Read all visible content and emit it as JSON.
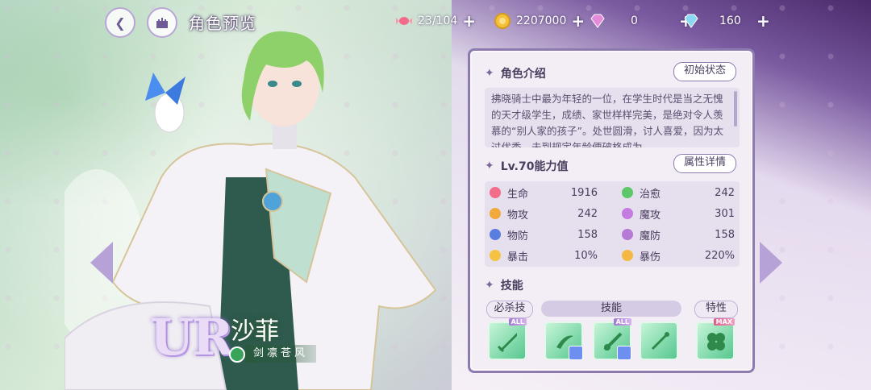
{
  "topbar": {
    "title": "角色预览",
    "resources": [
      {
        "icon": "candy-icon",
        "value": "23/104"
      },
      {
        "icon": "gold-coin-icon",
        "value": "2207000"
      },
      {
        "icon": "pink-gem-icon",
        "value": "0"
      },
      {
        "icon": "blue-diamond-icon",
        "value": "160"
      }
    ]
  },
  "character": {
    "rarity": "UR",
    "name": "沙菲",
    "title": "剑凛苍风"
  },
  "panel": {
    "intro": {
      "heading": "角色介绍",
      "button": "初始状态",
      "text": "拂晓骑士中最为年轻的一位，在学生时代是当之无愧的天才级学生，成绩、家世样样完美，是绝对令人羡慕的“别人家的孩子”。处世圆滑，讨人喜爱，因为太过优秀，未到规定年龄便破格成为"
    },
    "stats": {
      "heading": "Lv.70能力值",
      "button": "属性详情",
      "items": [
        {
          "label": "生命",
          "value": "1916",
          "color": "#f26d8a"
        },
        {
          "label": "治愈",
          "value": "242",
          "color": "#5cc86a"
        },
        {
          "label": "物攻",
          "value": "242",
          "color": "#f2a93b"
        },
        {
          "label": "魔攻",
          "value": "301",
          "color": "#c57be0"
        },
        {
          "label": "物防",
          "value": "158",
          "color": "#5a7ee0"
        },
        {
          "label": "魔防",
          "value": "158",
          "color": "#b57ad6"
        },
        {
          "label": "暴击",
          "value": "10%",
          "color": "#f5c242"
        },
        {
          "label": "暴伤",
          "value": "220%",
          "color": "#f5b842"
        }
      ]
    },
    "skills": {
      "heading": "技能",
      "labels": {
        "ultimate": "必杀技",
        "skill": "技能",
        "trait": "特性"
      },
      "tags": {
        "all": "ALL",
        "max": "MAX"
      }
    }
  }
}
